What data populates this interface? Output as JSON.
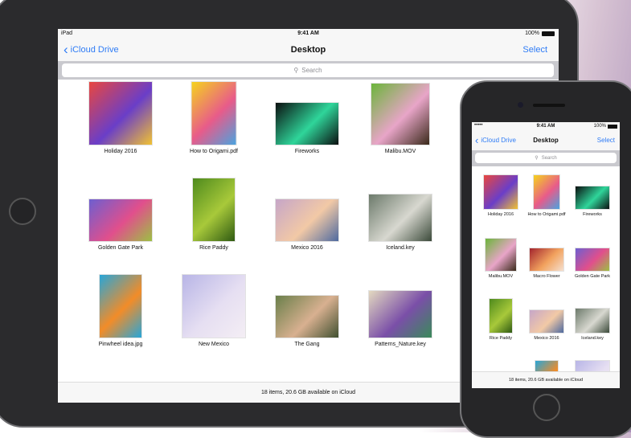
{
  "ipad": {
    "status": {
      "carrier": "iPad",
      "time": "9:41 AM",
      "battery": "100%"
    },
    "nav": {
      "back_label": "iCloud Drive",
      "title": "Desktop",
      "select_label": "Select"
    },
    "search": {
      "placeholder": "Search"
    },
    "footer": "18 items, 20.6 GB available on iCloud",
    "items": [
      {
        "name": "Holiday 2016",
        "colors": [
          "#e9473f",
          "#6a3ec8",
          "#f1c232"
        ]
      },
      {
        "name": "How to Origami.pdf",
        "colors": [
          "#f5d31e",
          "#e85b8a",
          "#4aa3df"
        ]
      },
      {
        "name": "Fireworks",
        "colors": [
          "#0b0f10",
          "#2fd59a",
          "#0b0f10"
        ]
      },
      {
        "name": "Malibu.MOV",
        "colors": [
          "#6bb53a",
          "#e8a5c8",
          "#3a2a1a"
        ]
      },
      {
        "name": "Golden Gate Park",
        "colors": [
          "#6d5fd0",
          "#e14f8c",
          "#9cc043"
        ]
      },
      {
        "name": "Rice Paddy",
        "colors": [
          "#4e8a1d",
          "#a8c93a",
          "#2f5a12"
        ]
      },
      {
        "name": "Mexico 2016",
        "colors": [
          "#c6a6c8",
          "#f2c9a6",
          "#4e6aa0"
        ]
      },
      {
        "name": "Iceland.key",
        "colors": [
          "#6c7a6b",
          "#d8d8d0",
          "#3b4a3a"
        ]
      },
      {
        "name": "Pinwheel idea.jpg",
        "colors": [
          "#27a6d9",
          "#f28c28",
          "#27a6d9"
        ]
      },
      {
        "name": "New Mexico",
        "colors": [
          "#b8b5e6",
          "#e6dff2",
          "#f4eef4"
        ]
      },
      {
        "name": "The Gang",
        "colors": [
          "#6a7f4a",
          "#d8b090",
          "#405030"
        ]
      },
      {
        "name": "Patterns_Nature.key",
        "colors": [
          "#e3d9c0",
          "#7a4fa8",
          "#3a8a5a"
        ]
      }
    ]
  },
  "iphone": {
    "status": {
      "signal": "•••••",
      "time": "9:41 AM",
      "battery": "100%"
    },
    "nav": {
      "back_label": "iCloud Drive",
      "title": "Desktop",
      "select_label": "Select"
    },
    "search": {
      "placeholder": "Search"
    },
    "footer": "18 items, 20.6 GB available on iCloud",
    "items": [
      {
        "name": "Holiday 2016",
        "colors": [
          "#e9473f",
          "#6a3ec8",
          "#f1c232"
        ]
      },
      {
        "name": "How to Origami.pdf",
        "colors": [
          "#f5d31e",
          "#e85b8a",
          "#4aa3df"
        ]
      },
      {
        "name": "Fireworks",
        "colors": [
          "#0b0f10",
          "#2fd59a",
          "#0b0f10"
        ]
      },
      {
        "name": "Malibu.MOV",
        "colors": [
          "#6bb53a",
          "#e8a5c8",
          "#3a2a1a"
        ]
      },
      {
        "name": "Macro Flower",
        "colors": [
          "#a3242e",
          "#f2a25e",
          "#f5e0d0"
        ]
      },
      {
        "name": "Golden Gate Park",
        "colors": [
          "#6d5fd0",
          "#e14f8c",
          "#9cc043"
        ]
      },
      {
        "name": "Rice Paddy",
        "colors": [
          "#4e8a1d",
          "#a8c93a",
          "#2f5a12"
        ]
      },
      {
        "name": "Mexico 2016",
        "colors": [
          "#c6a6c8",
          "#f2c9a6",
          "#4e6aa0"
        ]
      },
      {
        "name": "Iceland.key",
        "colors": [
          "#6c7a6b",
          "#d8d8d0",
          "#3b4a3a"
        ]
      },
      {
        "name": "",
        "colors": [
          "#f4f4f4",
          "#cfe0ee",
          "#f4f4f4"
        ]
      },
      {
        "name": "",
        "colors": [
          "#27a6d9",
          "#f28c28",
          "#27a6d9"
        ]
      },
      {
        "name": "",
        "colors": [
          "#b8b5e6",
          "#e6dff2",
          "#f4eef4"
        ]
      }
    ]
  }
}
